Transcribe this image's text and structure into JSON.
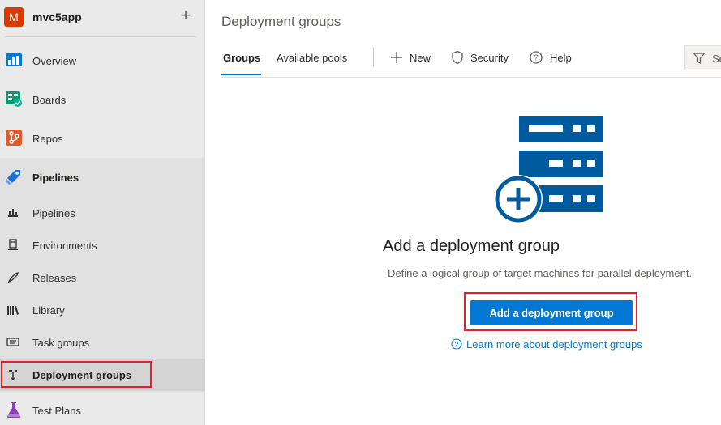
{
  "project": {
    "avatar_letter": "M",
    "name": "mvc5app",
    "add_symbol": "+"
  },
  "sidebar": {
    "items": [
      {
        "label": "Overview",
        "icon": "overview-icon"
      },
      {
        "label": "Boards",
        "icon": "boards-icon"
      },
      {
        "label": "Repos",
        "icon": "repos-icon"
      },
      {
        "label": "Pipelines",
        "icon": "pipelines-icon"
      }
    ],
    "pipelines_sub": [
      {
        "label": "Pipelines",
        "icon": "pipeline-sub-icon"
      },
      {
        "label": "Environments",
        "icon": "environments-icon"
      },
      {
        "label": "Releases",
        "icon": "releases-icon"
      },
      {
        "label": "Library",
        "icon": "library-icon"
      },
      {
        "label": "Task groups",
        "icon": "task-groups-icon"
      },
      {
        "label": "Deployment groups",
        "icon": "deployment-groups-icon",
        "active": true
      }
    ],
    "after": {
      "label": "Test Plans",
      "icon": "test-plans-icon"
    }
  },
  "main": {
    "title": "Deployment groups",
    "tabs": [
      {
        "label": "Groups",
        "active": true
      },
      {
        "label": "Available pools",
        "active": false
      }
    ],
    "toolbar": {
      "new_label": "New",
      "security_label": "Security",
      "help_label": "Help",
      "search_placeholder": "Search"
    },
    "empty_state": {
      "title": "Add a deployment group",
      "description": "Define a logical group of target machines for parallel deployment.",
      "button_label": "Add a deployment group",
      "learn_more": "Learn more about deployment groups"
    }
  },
  "colors": {
    "accent": "#0078d4",
    "highlight": "#e0202f",
    "project_avatar": "#d83b01",
    "hero": "#005a9e"
  }
}
